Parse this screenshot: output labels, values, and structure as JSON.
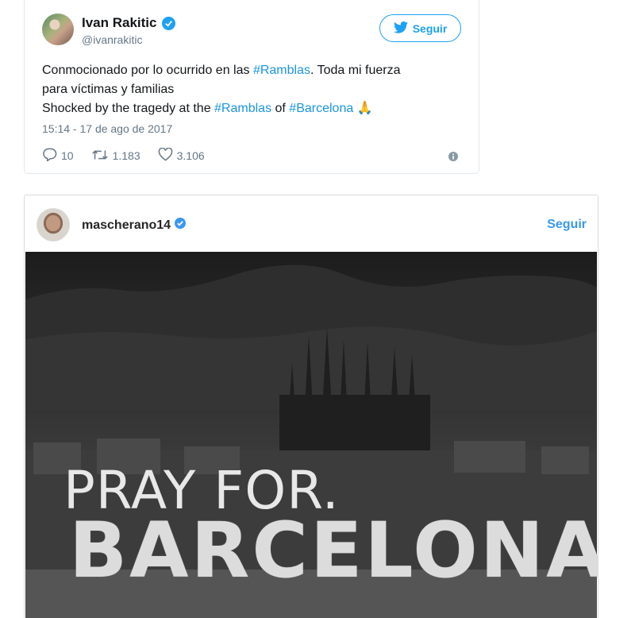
{
  "tweet": {
    "name": "Ivan Rakitic",
    "handle": "@ivanrakitic",
    "follow_label": "Seguir",
    "text_line1_pre": "Conmocionado por lo ocurrido en las ",
    "text_line1_hash": "#Ramblas",
    "text_line1_post": ". Toda mi fuerza",
    "text_line2": "para víctimas y familias",
    "text_line3_pre": "Shocked by the tragedy at the ",
    "text_line3_hash1": "#Ramblas",
    "text_line3_mid": " of ",
    "text_line3_hash2": "#Barcelona",
    "text_line3_emoji": "🙏",
    "date": "15:14 - 17 de ago de 2017",
    "replies": "10",
    "retweets": "1.183",
    "likes": "3.106",
    "icons": [
      "verified-icon",
      "twitter-bird-icon",
      "reply-icon",
      "retweet-icon",
      "heart-icon",
      "info-icon"
    ],
    "colors": {
      "accent": "#1da1f2",
      "hashtag": "#1b95e0",
      "muted": "#657786"
    }
  },
  "instagram": {
    "username": "mascherano14",
    "follow_label": "Seguir",
    "image_text_line1": "PRAY FOR.",
    "image_text_line2": "BARCELONA",
    "icons": [
      "verified-icon"
    ],
    "colors": {
      "follow": "#3897f0"
    }
  }
}
